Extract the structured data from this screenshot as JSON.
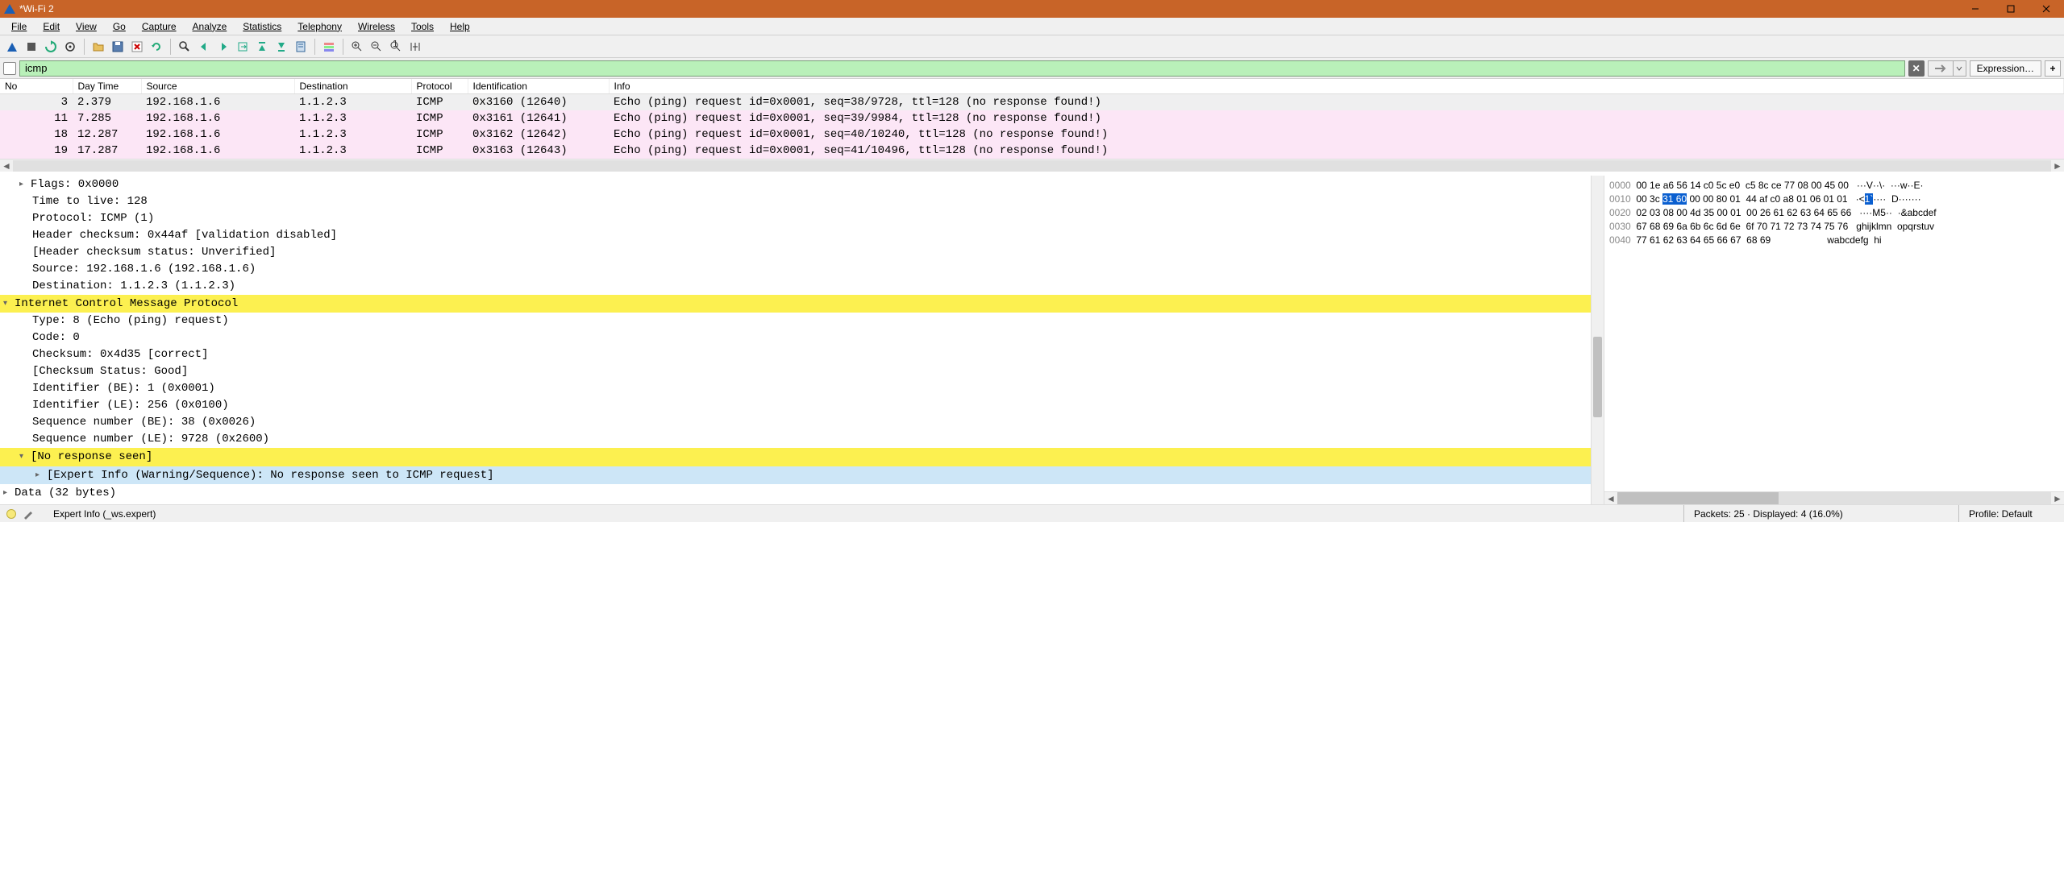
{
  "window": {
    "title": "*Wi-Fi 2"
  },
  "menu": {
    "file": "File",
    "edit": "Edit",
    "view": "View",
    "go": "Go",
    "capture": "Capture",
    "analyze": "Analyze",
    "statistics": "Statistics",
    "telephony": "Telephony",
    "wireless": "Wireless",
    "tools": "Tools",
    "help": "Help"
  },
  "filter": {
    "value": "icmp",
    "expression_label": "Expression…"
  },
  "packet_columns": {
    "no": "No",
    "time": "Day Time",
    "source": "Source",
    "destination": "Destination",
    "protocol": "Protocol",
    "identification": "Identification",
    "info": "Info"
  },
  "packets": [
    {
      "no": "3",
      "time": "2.379",
      "src": "192.168.1.6",
      "dst": "1.1.2.3",
      "proto": "ICMP",
      "id": "0x3160 (12640)",
      "info": "Echo (ping) request  id=0x0001, seq=38/9728, ttl=128 (no response found!)"
    },
    {
      "no": "11",
      "time": "7.285",
      "src": "192.168.1.6",
      "dst": "1.1.2.3",
      "proto": "ICMP",
      "id": "0x3161 (12641)",
      "info": "Echo (ping) request  id=0x0001, seq=39/9984, ttl=128 (no response found!)"
    },
    {
      "no": "18",
      "time": "12.287",
      "src": "192.168.1.6",
      "dst": "1.1.2.3",
      "proto": "ICMP",
      "id": "0x3162 (12642)",
      "info": "Echo (ping) request  id=0x0001, seq=40/10240, ttl=128 (no response found!)"
    },
    {
      "no": "19",
      "time": "17.287",
      "src": "192.168.1.6",
      "dst": "1.1.2.3",
      "proto": "ICMP",
      "id": "0x3163 (12643)",
      "info": "Echo (ping) request  id=0x0001, seq=41/10496, ttl=128 (no response found!)"
    }
  ],
  "details": {
    "rows": [
      {
        "lvl": 1,
        "arrow": ">",
        "text": "Flags: 0x0000"
      },
      {
        "lvl": 1,
        "text": "Time to live: 128"
      },
      {
        "lvl": 1,
        "text": "Protocol: ICMP (1)"
      },
      {
        "lvl": 1,
        "text": "Header checksum: 0x44af [validation disabled]"
      },
      {
        "lvl": 1,
        "text": "[Header checksum status: Unverified]"
      },
      {
        "lvl": 1,
        "text": "Source: 192.168.1.6 (192.168.1.6)"
      },
      {
        "lvl": 1,
        "text": "Destination: 1.1.2.3 (1.1.2.3)"
      },
      {
        "lvl": 0,
        "arrow": "v",
        "hl": "yellow",
        "text": "Internet Control Message Protocol"
      },
      {
        "lvl": 1,
        "text": "Type: 8 (Echo (ping) request)"
      },
      {
        "lvl": 1,
        "text": "Code: 0"
      },
      {
        "lvl": 1,
        "text": "Checksum: 0x4d35 [correct]"
      },
      {
        "lvl": 1,
        "text": "[Checksum Status: Good]"
      },
      {
        "lvl": 1,
        "text": "Identifier (BE): 1 (0x0001)"
      },
      {
        "lvl": 1,
        "text": "Identifier (LE): 256 (0x0100)"
      },
      {
        "lvl": 1,
        "text": "Sequence number (BE): 38 (0x0026)"
      },
      {
        "lvl": 1,
        "text": "Sequence number (LE): 9728 (0x2600)"
      },
      {
        "lvl": 1,
        "arrow": "v",
        "hl": "yellow",
        "text": "[No response seen]"
      },
      {
        "lvl": 2,
        "arrow": ">",
        "hl": "blue",
        "text": "[Expert Info (Warning/Sequence): No response seen to ICMP request]"
      },
      {
        "lvl": 0,
        "arrow": ">",
        "text": "Data (32 bytes)"
      }
    ]
  },
  "hex": {
    "rows": [
      {
        "off": "0000",
        "b1": "00 1e a6 56 14 c0 5c e0",
        "b2": "c5 8c ce 77 08 00 45 00",
        "a": "···V··\\·  ···w··E·"
      },
      {
        "off": "0010",
        "b1_pre": "00 3c ",
        "b1_sel": "31 60",
        "b1_post": " 00 00 80 01",
        "b2": "44 af c0 a8 01 06 01 01",
        "a_pre": "·<",
        "a_sel": "1`",
        "a_post": "····  D·······"
      },
      {
        "off": "0020",
        "b1": "02 03 08 00 4d 35 00 01",
        "b2": "00 26 61 62 63 64 65 66",
        "a": "····M5··  ·&abcdef"
      },
      {
        "off": "0030",
        "b1": "67 68 69 6a 6b 6c 6d 6e",
        "b2": "6f 70 71 72 73 74 75 76",
        "a": "ghijklmn  opqrstuv"
      },
      {
        "off": "0040",
        "b1": "77 61 62 63 64 65 66 67",
        "b2": "68 69",
        "a": "wabcdefg  hi"
      }
    ]
  },
  "status": {
    "expert": "Expert Info (_ws.expert)",
    "packets": "Packets: 25 · Displayed: 4 (16.0%)",
    "profile": "Profile: Default"
  }
}
